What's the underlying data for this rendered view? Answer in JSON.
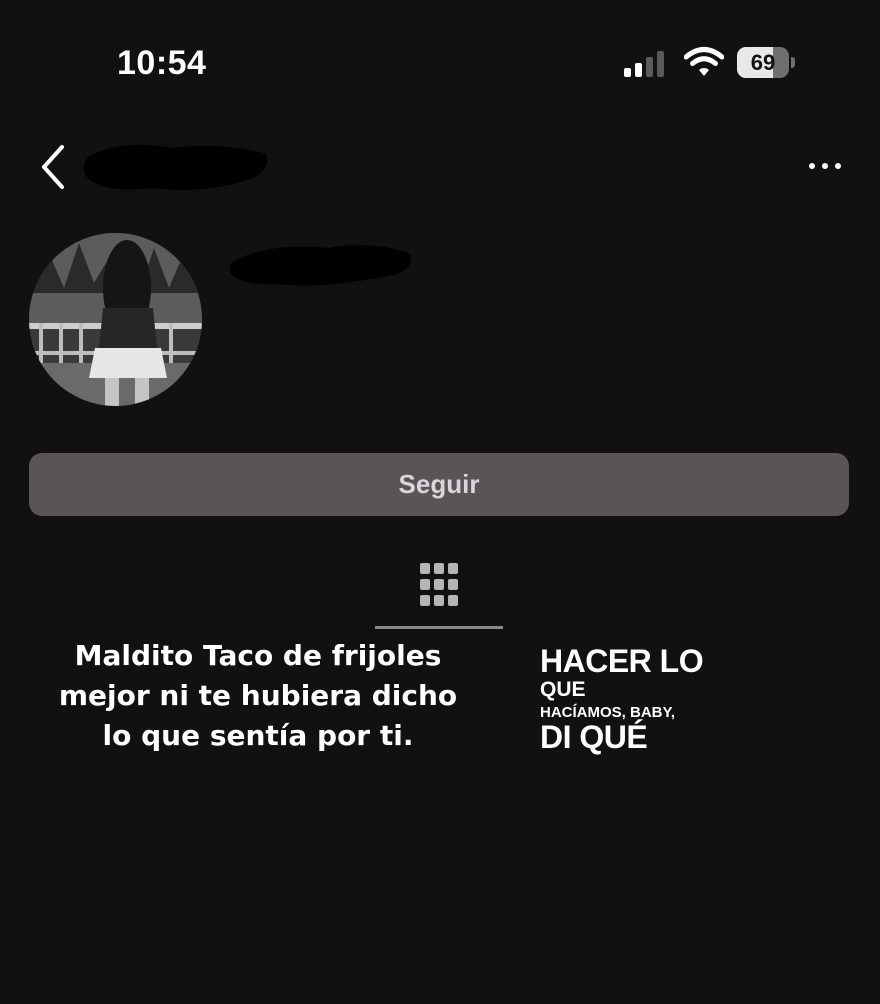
{
  "status_bar": {
    "time": "10:54",
    "battery_level": 69,
    "battery_label": "69",
    "signal_bars_active": 2,
    "signal_bars_total": 4,
    "icons": [
      "signal-icon",
      "wifi-icon",
      "battery-icon"
    ]
  },
  "header": {
    "back_icon": "chevron-left-icon",
    "more_icon": "ellipsis-icon",
    "username_redacted": true
  },
  "profile": {
    "name_redacted": true,
    "avatar": "profile-photo"
  },
  "actions": {
    "follow_label": "Seguir"
  },
  "tabs": {
    "active": "grid-icon"
  },
  "posts": [
    {
      "lines": [
        "Maldito Taco de frijoles",
        "mejor ni te hubiera dicho",
        "lo que sentía por ti."
      ]
    },
    {
      "lines": [
        "HACER LO",
        "QUE",
        "HACÍAMOS, BABY,",
        "DI QUÉ"
      ]
    }
  ],
  "colors": {
    "background": "#111111",
    "button_bg": "#595557",
    "button_text": "#d8d6d8",
    "text": "#ffffff"
  }
}
